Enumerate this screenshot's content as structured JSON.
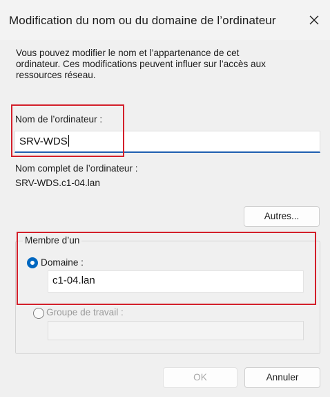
{
  "window": {
    "title": "Modification du nom ou du domaine de l’ordinateur",
    "close_icon": "close-icon"
  },
  "description": {
    "line1": "Vous pouvez modifier le nom et l’appartenance de cet",
    "line2": "ordinateur. Ces modifications peuvent influer sur l’accès aux",
    "line3": "ressources réseau."
  },
  "computer_name": {
    "label": "Nom de l’ordinateur :",
    "value": "SRV-WDS"
  },
  "full_name": {
    "label": "Nom complet de l’ordinateur :",
    "value": "SRV-WDS.c1-04.lan"
  },
  "more_button": {
    "label": "Autres..."
  },
  "member_of": {
    "legend": "Membre d’un",
    "domain": {
      "label": "Domaine :",
      "value": "c1-04.lan",
      "selected": true
    },
    "workgroup": {
      "label": "Groupe de travail :",
      "value": "",
      "selected": false
    }
  },
  "footer": {
    "ok_label": "OK",
    "cancel_label": "Annuler"
  },
  "colors": {
    "accent": "#0067c0",
    "highlight": "#d31f2a",
    "background": "#f0f0f0"
  }
}
